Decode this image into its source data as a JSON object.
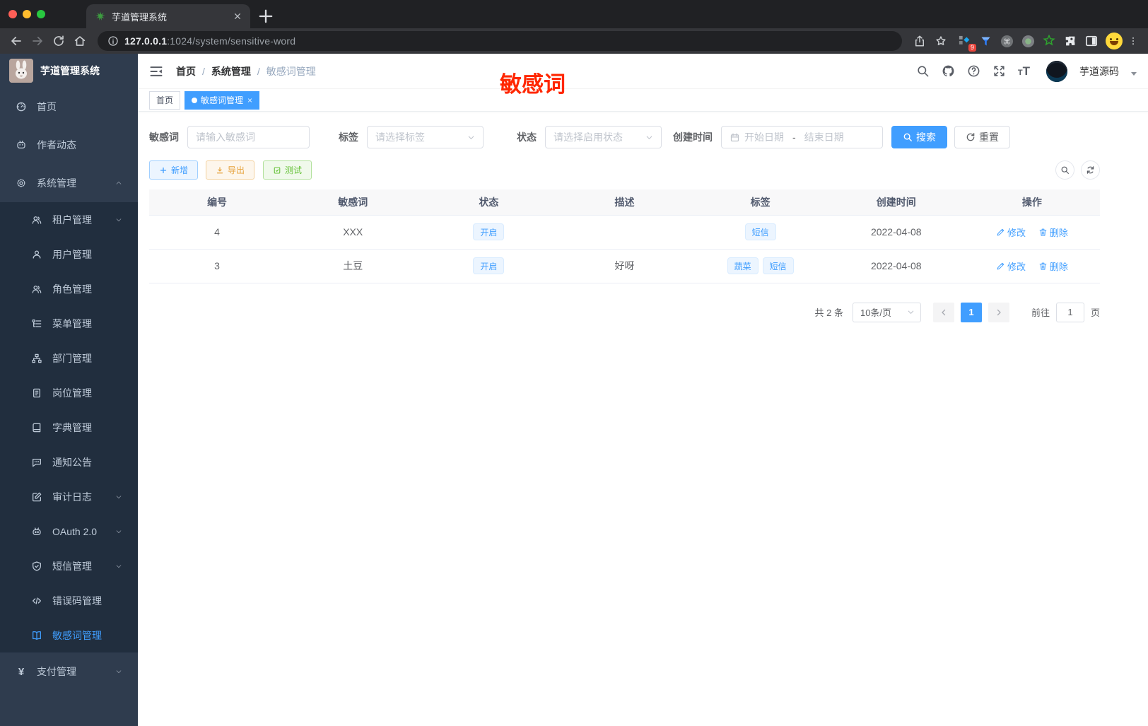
{
  "colors": {
    "accent": "#409eff",
    "warning": "#e6a23c",
    "success": "#67c23a",
    "annotation_red": "#ff2700",
    "sidebar_bg": "#2f3c4e",
    "submenu_bg": "#212e3e"
  },
  "browser": {
    "tab_title": "芋道管理系统",
    "url_host": "127.0.0.1",
    "url_rest": ":1024/system/sensitive-word",
    "extensions": [
      {
        "icon": "grid-diamond-icon",
        "badge": "9"
      },
      {
        "icon": "funnel-icon"
      },
      {
        "icon": "command-circle-icon"
      },
      {
        "icon": "record-circle-icon"
      },
      {
        "icon": "green-star-icon"
      },
      {
        "icon": "puzzle-icon"
      },
      {
        "icon": "split-view-icon"
      }
    ]
  },
  "sidebar": {
    "title": "芋道管理系统",
    "items": [
      {
        "label": "首页",
        "icon": "dashboard-icon",
        "level": "top"
      },
      {
        "label": "作者动态",
        "icon": "chat-icon",
        "level": "top"
      },
      {
        "label": "系统管理",
        "icon": "gear-icon",
        "level": "top",
        "arrow": "up"
      },
      {
        "label": "租户管理",
        "icon": "tenants-icon",
        "level": "sub",
        "arrow": "down"
      },
      {
        "label": "用户管理",
        "icon": "user-icon",
        "level": "sub"
      },
      {
        "label": "角色管理",
        "icon": "roles-icon",
        "level": "sub"
      },
      {
        "label": "菜单管理",
        "icon": "menu-tree-icon",
        "level": "sub"
      },
      {
        "label": "部门管理",
        "icon": "org-tree-icon",
        "level": "sub"
      },
      {
        "label": "岗位管理",
        "icon": "badge-icon",
        "level": "sub"
      },
      {
        "label": "字典管理",
        "icon": "dict-book-icon",
        "level": "sub"
      },
      {
        "label": "通知公告",
        "icon": "notice-bubble-icon",
        "level": "sub"
      },
      {
        "label": "审计日志",
        "icon": "audit-log-icon",
        "level": "sub",
        "arrow": "down"
      },
      {
        "label": "OAuth 2.0",
        "icon": "robot-icon",
        "level": "sub",
        "arrow": "down"
      },
      {
        "label": "短信管理",
        "icon": "shield-check-icon",
        "level": "sub",
        "arrow": "down"
      },
      {
        "label": "错误码管理",
        "icon": "code-icon",
        "level": "sub"
      },
      {
        "label": "敏感词管理",
        "icon": "open-book-icon",
        "level": "sub",
        "active": true
      },
      {
        "label": "支付管理",
        "icon": "yen-icon",
        "level": "top",
        "arrow": "down"
      }
    ]
  },
  "header": {
    "breadcrumb": [
      "首页",
      "系统管理",
      "敏感词管理"
    ],
    "username": "芋道源码",
    "annotation": "敏感词"
  },
  "tags_view": [
    {
      "label": "首页",
      "active": false
    },
    {
      "label": "敏感词管理",
      "active": true,
      "closable": true
    }
  ],
  "filters": {
    "keyword_label": "敏感词",
    "keyword_placeholder": "请输入敏感词",
    "tag_label": "标签",
    "tag_placeholder": "请选择标签",
    "status_label": "状态",
    "status_placeholder": "请选择启用状态",
    "date_label": "创建时间",
    "date_start_placeholder": "开始日期",
    "date_separator": "-",
    "date_end_placeholder": "结束日期",
    "search_label": "搜索",
    "reset_label": "重置"
  },
  "toolbar": {
    "add_label": "新增",
    "export_label": "导出",
    "test_label": "测试"
  },
  "table": {
    "columns": [
      "编号",
      "敏感词",
      "状态",
      "描述",
      "标签",
      "创建时间",
      "操作"
    ],
    "rows": [
      {
        "id": "4",
        "word": "XXX",
        "status": "开启",
        "description": "",
        "tags": [
          "短信"
        ],
        "created": "2022-04-08"
      },
      {
        "id": "3",
        "word": "土豆",
        "status": "开启",
        "description": "好呀",
        "tags": [
          "蔬菜",
          "短信"
        ],
        "created": "2022-04-08"
      }
    ],
    "edit_label": "修改",
    "delete_label": "删除"
  },
  "pagination": {
    "total_text": "共 2 条",
    "page_size": "10条/页",
    "current_page": "1",
    "goto_label": "前往",
    "goto_value": "1",
    "page_suffix": "页"
  }
}
